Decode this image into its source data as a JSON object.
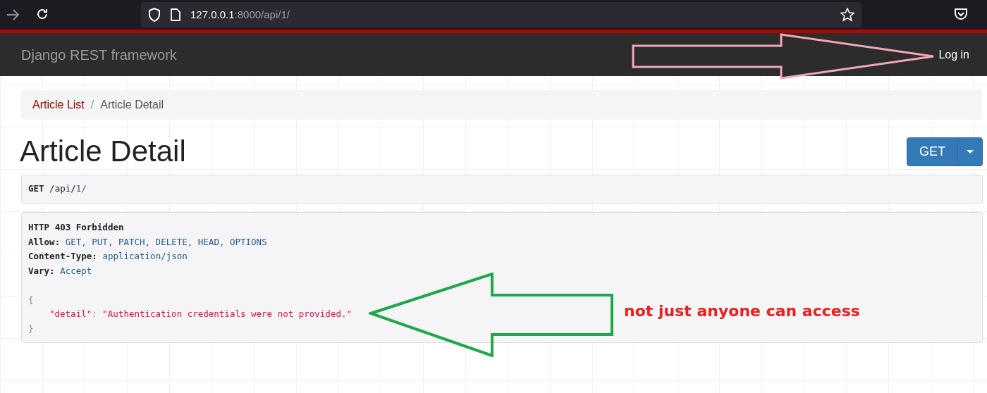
{
  "browser": {
    "url_host": "127.0.0.1",
    "url_rest": ":8000/api/1/"
  },
  "navbar": {
    "brand": "Django REST framework",
    "login": "Log in"
  },
  "breadcrumb_separator": "/",
  "breadcrumb": [
    {
      "label": "Article List",
      "selected": false
    },
    {
      "label": "Article Detail",
      "selected": true
    }
  ],
  "heading": "Article Detail",
  "method_button": "GET",
  "request": {
    "method": "GET",
    "path": [
      {
        "text": "/api/",
        "kind": "plain"
      },
      {
        "text": "1",
        "kind": "link"
      },
      {
        "text": "/",
        "kind": "link"
      }
    ]
  },
  "response": {
    "status": "HTTP 403 Forbidden",
    "headers": [
      {
        "name": "Allow:",
        "value": "GET, PUT, PATCH, DELETE, HEAD, OPTIONS"
      },
      {
        "name": "Content-Type:",
        "value": "application/json"
      },
      {
        "name": "Vary:",
        "value": "Accept"
      }
    ],
    "open_brace": "{",
    "key": "\"detail\"",
    "colon": ":",
    "value": "\"Authentication credentials were not provided.\"",
    "close_brace": "}"
  },
  "annotation": "not just anyone can access"
}
